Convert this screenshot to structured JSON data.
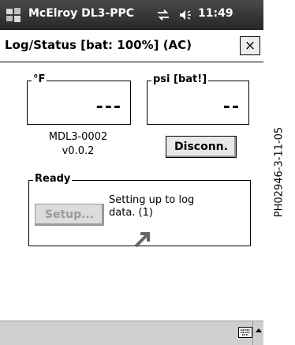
{
  "titlebar": {
    "app_title": "McElroy DL3-PPC",
    "time": "11:49"
  },
  "dialog": {
    "title": "Log/Status  [bat: 100%] (AC)",
    "close_label": "×"
  },
  "temperature": {
    "label": "°F",
    "value": "---"
  },
  "pressure": {
    "label": "psi [bat!]",
    "value": "--"
  },
  "device_info": {
    "model": "MDL3-0002",
    "version": "v0.0.2"
  },
  "disconnect_label": "Disconn.",
  "ready_group": {
    "label": "Ready",
    "setup_label": "Setup...",
    "status_text": "Setting up to log data. (1)"
  },
  "figure_code": "PH02946-3-11-05"
}
